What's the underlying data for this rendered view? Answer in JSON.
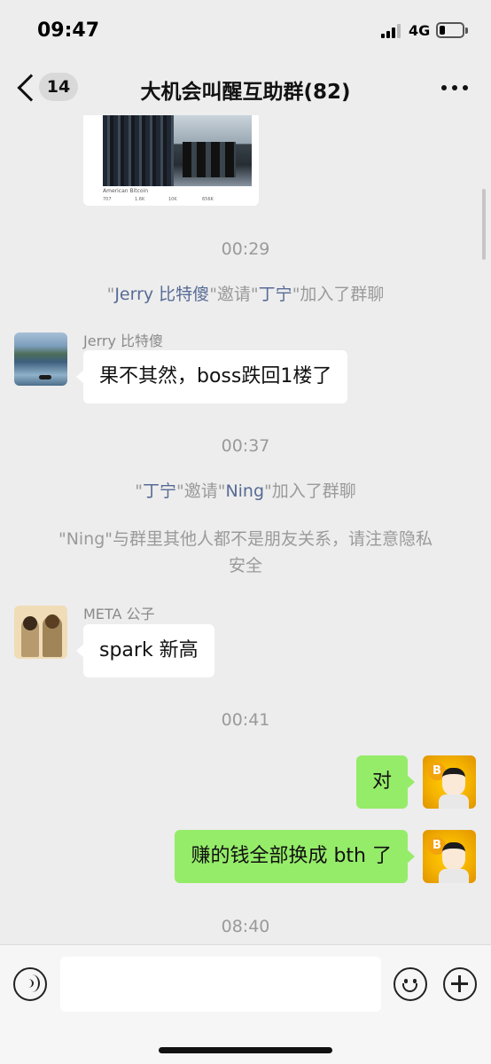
{
  "status": {
    "time": "09:47",
    "network": "4G",
    "icons": [
      "signal-icon",
      "battery-icon"
    ]
  },
  "header": {
    "back_icon": "chevron-left-icon",
    "unread_count": "14",
    "title": "大机会叫醒互助群(82)",
    "more_icon": "more-dots-icon"
  },
  "shared_image": {
    "caption": "American Bitcoin",
    "stats": [
      "707",
      "1.6K",
      "10K",
      "656K"
    ]
  },
  "messages": {
    "t1": "00:29",
    "sys1": {
      "q1": "\"",
      "a": "Jerry 比特傻",
      "q2": "\"邀请\"",
      "b": "丁宁",
      "q3": "\"加入了群聊"
    },
    "m1": {
      "sender": "Jerry 比特傻",
      "text": "果不其然，boss跌回1楼了"
    },
    "t2": "00:37",
    "sys2": {
      "q1": "\"",
      "a": "丁宁",
      "q2": "\"邀请\"",
      "b": "Ning",
      "q3": "\"加入了群聊"
    },
    "sys3_line1": "\"Ning\"与群里其他人都不是朋友关系，请注意隐私",
    "sys3_line2": "安全",
    "m2": {
      "sender": "META 公子",
      "text": "spark 新高"
    },
    "t3": "00:41",
    "m3": {
      "text": "对"
    },
    "m4": {
      "text": "赚的钱全部换成 bth 了"
    },
    "t4": "08:40"
  },
  "composer": {
    "voice_icon": "voice-icon",
    "input_value": "",
    "emoji_icon": "emoji-icon",
    "plus_icon": "plus-icon",
    "coin_symbol": "B"
  },
  "colors": {
    "background": "#ededed",
    "my_bubble": "#95ec69",
    "their_bubble": "#ffffff",
    "system_text": "#9a9a9a",
    "highlight_name": "#576b95"
  }
}
